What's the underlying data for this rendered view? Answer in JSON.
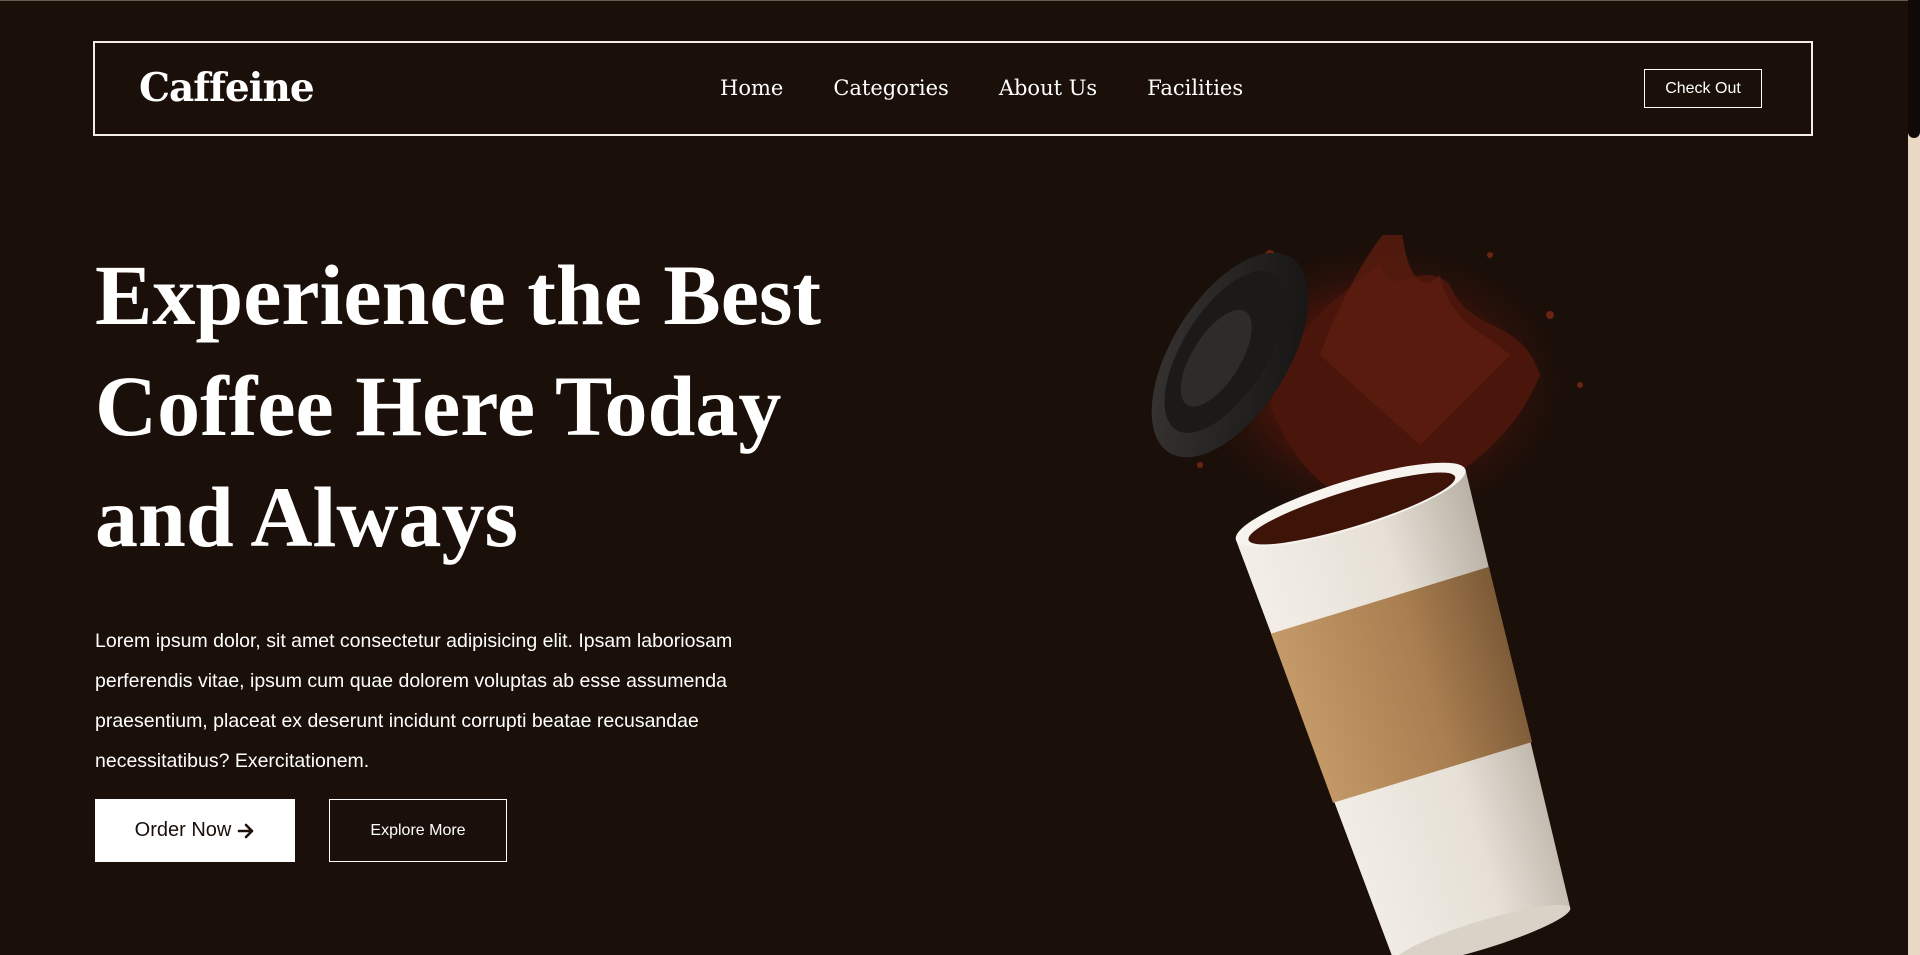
{
  "nav": {
    "logo": "Caffeine",
    "links": [
      "Home",
      "Categories",
      "About Us",
      "Facilities"
    ],
    "checkout_label": "Check Out"
  },
  "hero": {
    "title_lines": [
      "Experience the Best",
      "Coffee Here Today",
      "and Always"
    ],
    "description": "Lorem ipsum dolor, sit amet consectetur adipisicing elit. Ipsam laboriosam perferendis vitae, ipsum cum quae dolorem voluptas ab esse assumenda praesentium, placeat ex deserunt incidunt corrupti beatae recusandae necessitatibus? Exercitationem.",
    "order_label": "Order Now",
    "order_icon": "arrow-right-icon",
    "explore_label": "Explore More",
    "image": "coffee-cup-splash-illustration"
  },
  "colors": {
    "background": "#1a0f09",
    "text": "#ffffff",
    "accent_strip": "#e9d8c3",
    "sleeve": "#b48a5c"
  }
}
